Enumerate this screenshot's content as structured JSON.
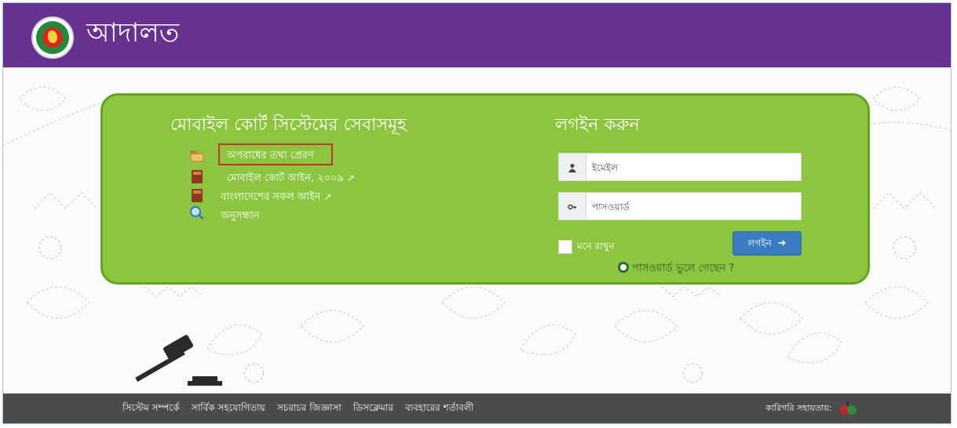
{
  "header": {
    "app_title": "আদালত",
    "logo_icon": "govt-seal-icon"
  },
  "services": {
    "title": "মোবাইল কোর্ট সিস্টেমের সেবাসমূহ",
    "items": [
      {
        "label": "অপরাধের তথ্য প্রেরণ",
        "icon": "folder-icon"
      },
      {
        "label": "মোবাইল কোর্ট আইন, ২০০৯",
        "icon": "law-book-icon",
        "external": "↗"
      },
      {
        "label": "বাংলাদেশের সকল আইন",
        "icon": "law-book-icon",
        "external": "↗"
      },
      {
        "label": "অনুসন্ধান",
        "icon": "magnifier-icon"
      }
    ]
  },
  "login": {
    "title": "লগইন করুন",
    "email_placeholder": "ইমেইল",
    "password_placeholder": "পাসওয়ার্ড",
    "remember_label": "মনে রাখুন",
    "login_button": "লগইন",
    "forgot_password": "পাসওয়ার্ড ভুলে গেছেন ?"
  },
  "footer": {
    "links": [
      "সিস্টেম সম্পর্কে",
      "সার্বিক সহযোগিতায়",
      "সচরাচর জিজ্ঞাসা",
      "ডিসক্লেমার",
      "ব্যবহারের শর্তাবলী"
    ],
    "support_label": "কারিগরি সহায়তায়:"
  },
  "colors": {
    "header": "#67318f",
    "panel": "#8cc63f",
    "panel_border": "#63a51f",
    "button": "#3a7cc1",
    "footer": "#4b4b4b",
    "highlight": "#c2352c"
  }
}
